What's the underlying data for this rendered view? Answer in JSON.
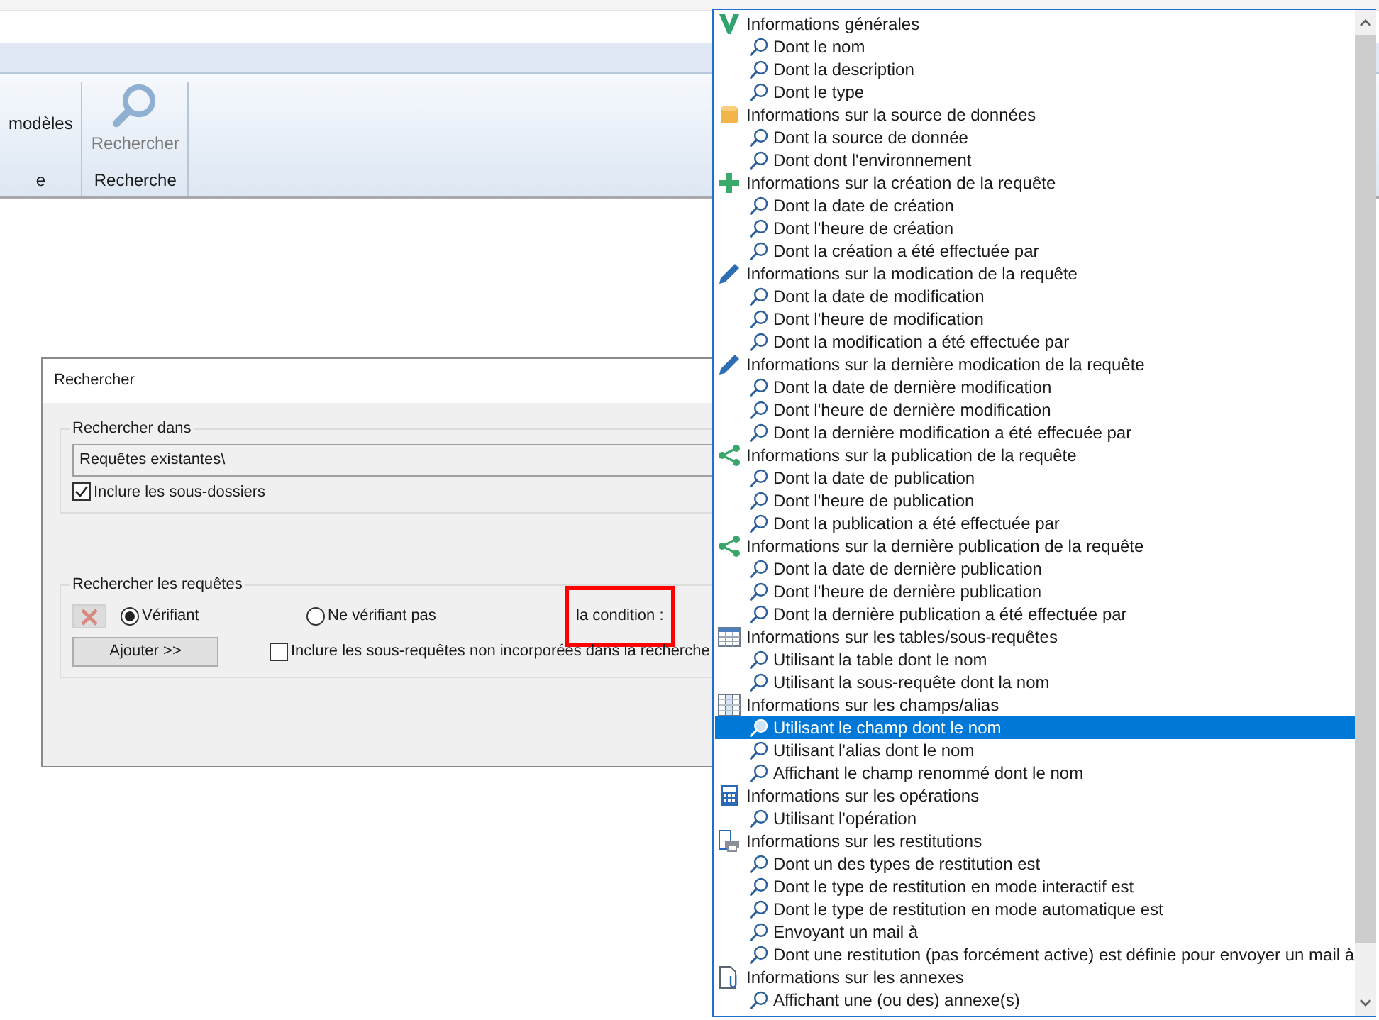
{
  "ribbon": {
    "groups": [
      {
        "label": "e",
        "buttons": [
          {
            "label": "modèles",
            "kind": "text",
            "disabled": false
          }
        ]
      },
      {
        "label": "Recherche",
        "buttons": [
          {
            "label": "Rechercher",
            "kind": "search",
            "disabled": true
          }
        ]
      }
    ]
  },
  "dialog": {
    "title": "Rechercher",
    "search_in": {
      "legend": "Rechercher dans",
      "path": "Requêtes existantes\\",
      "include_subfolders": {
        "label": "Inclure les sous-dossiers",
        "checked": true
      }
    },
    "queries": {
      "legend": "Rechercher les requêtes",
      "remove_disabled": true,
      "radios": [
        {
          "label": "Vérifiant",
          "selected": true
        },
        {
          "label": "Ne vérifiant pas",
          "selected": false
        }
      ],
      "condition": {
        "label": "la condition :",
        "highlighted": true
      },
      "add_button": "Ajouter >>",
      "include_subqueries": {
        "label": "Inclure les sous-requêtes non incorporées dans la recherche",
        "checked": false
      }
    }
  },
  "dropdown": {
    "groups": [
      {
        "kind": "check",
        "label": "Informations générales",
        "children": [
          {
            "label": "Dont le nom",
            "selected": false
          },
          {
            "label": "Dont la description",
            "selected": false
          },
          {
            "label": "Dont le type",
            "selected": false
          }
        ]
      },
      {
        "kind": "database",
        "label": "Informations sur la source de données",
        "children": [
          {
            "label": "Dont la source de donnée",
            "selected": false
          },
          {
            "label": "Dont dont l'environnement",
            "selected": false
          }
        ]
      },
      {
        "kind": "plus",
        "label": "Informations sur la création de la requête",
        "children": [
          {
            "label": "Dont la date de création",
            "selected": false
          },
          {
            "label": "Dont l'heure de création",
            "selected": false
          },
          {
            "label": "Dont la création a été effectuée par",
            "selected": false
          }
        ]
      },
      {
        "kind": "pencil",
        "label": "Informations sur la modication de la requête",
        "children": [
          {
            "label": "Dont la date de modification",
            "selected": false
          },
          {
            "label": "Dont l'heure de modification",
            "selected": false
          },
          {
            "label": "Dont la modification a été effectuée par",
            "selected": false
          }
        ]
      },
      {
        "kind": "pencil",
        "label": "Informations sur la dernière modication de la requête",
        "children": [
          {
            "label": "Dont la date de dernière modification",
            "selected": false
          },
          {
            "label": "Dont l'heure de dernière modification",
            "selected": false
          },
          {
            "label": "Dont la dernière modification a été effecuée par",
            "selected": false
          }
        ]
      },
      {
        "kind": "share",
        "label": "Informations sur la publication de la requête",
        "children": [
          {
            "label": "Dont la date de publication",
            "selected": false
          },
          {
            "label": "Dont l'heure de publication",
            "selected": false
          },
          {
            "label": "Dont la publication a été effectuée par",
            "selected": false
          }
        ]
      },
      {
        "kind": "share",
        "label": "Informations sur la dernière publication de la requête",
        "children": [
          {
            "label": "Dont la date de dernière publication",
            "selected": false
          },
          {
            "label": "Dont l'heure de dernière publication",
            "selected": false
          },
          {
            "label": "Dont la dernière publication a été effectuée par",
            "selected": false
          }
        ]
      },
      {
        "kind": "table",
        "label": "Informations sur les tables/sous-requêtes",
        "children": [
          {
            "label": "Utilisant la table dont le nom",
            "selected": false
          },
          {
            "label": "Utilisant la sous-requête dont la nom",
            "selected": false
          }
        ]
      },
      {
        "kind": "columns",
        "label": "Informations sur les champs/alias",
        "children": [
          {
            "label": "Utilisant le champ dont le nom",
            "selected": true
          },
          {
            "label": "Utilisant l'alias dont le nom",
            "selected": false
          },
          {
            "label": "Affichant le champ renommé dont le nom",
            "selected": false
          }
        ]
      },
      {
        "kind": "calculator",
        "label": "Informations sur les opérations",
        "children": [
          {
            "label": "Utilisant l'opération",
            "selected": false
          }
        ]
      },
      {
        "kind": "printer",
        "label": "Informations sur les restitutions",
        "children": [
          {
            "label": "Dont un des types de restitution est",
            "selected": false
          },
          {
            "label": "Dont le type de restitution en mode interactif est",
            "selected": false
          },
          {
            "label": "Dont le type de restitution en mode automatique est",
            "selected": false
          },
          {
            "label": "Envoyant un mail à",
            "selected": false
          },
          {
            "label": "Dont une restitution (pas forcément active) est définie pour envoyer un mail à",
            "selected": false
          }
        ]
      },
      {
        "kind": "attachment",
        "label": "Informations sur les annexes",
        "children": [
          {
            "label": "Affichant une (ou des) annexe(s)",
            "selected": false
          }
        ]
      }
    ]
  }
}
